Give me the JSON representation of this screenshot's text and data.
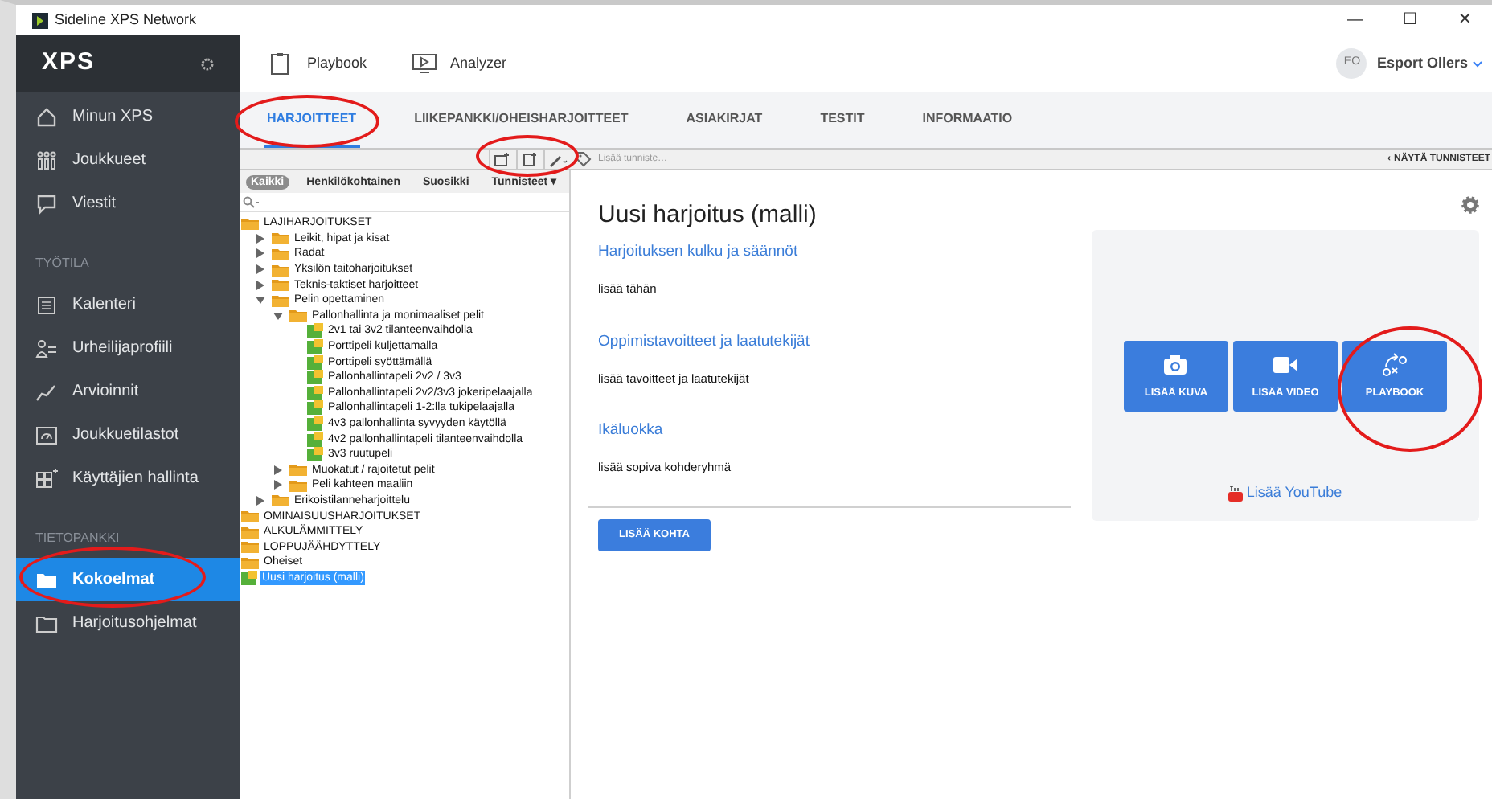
{
  "window": {
    "title": "Sideline XPS Network",
    "controls": [
      "—",
      "☐",
      "✕"
    ]
  },
  "sidebar": {
    "logo": "XPS",
    "items": [
      {
        "kind": "item",
        "label": "Minun XPS",
        "selected": false
      },
      {
        "kind": "item",
        "label": "Joukkueet",
        "selected": false
      },
      {
        "kind": "item",
        "label": "Viestit",
        "selected": false
      },
      {
        "kind": "header",
        "label": "TYÖTILA"
      },
      {
        "kind": "item",
        "label": "Kalenteri",
        "selected": false
      },
      {
        "kind": "item",
        "label": "Urheilijaprofiili",
        "selected": false
      },
      {
        "kind": "item",
        "label": "Arvioinnit",
        "selected": false
      },
      {
        "kind": "item",
        "label": "Joukkuetilastot",
        "selected": false
      },
      {
        "kind": "item",
        "label": "Käyttäjien hallinta",
        "selected": false
      },
      {
        "kind": "header",
        "label": "TIETOPANKKI"
      },
      {
        "kind": "item",
        "label": "Kokoelmat",
        "selected": true
      },
      {
        "kind": "item",
        "label": "Harjoitusohjelmat",
        "selected": false
      }
    ]
  },
  "apps": [
    {
      "label": "Playbook"
    },
    {
      "label": "Analyzer"
    }
  ],
  "user": {
    "initials": "EO",
    "name": "Esport Ollers"
  },
  "tabs": [
    {
      "label": "HARJOITTEET",
      "selected": true
    },
    {
      "label": "LIIKEPANKKI/OHEISHARJOITTEET",
      "selected": false
    },
    {
      "label": "ASIAKIRJAT",
      "selected": false
    },
    {
      "label": "TESTIT",
      "selected": false
    },
    {
      "label": "INFORMAATIO",
      "selected": false
    }
  ],
  "tag_bar": {
    "placeholder": "Lisää tunniste…",
    "show_tags": "NÄYTÄ TUNNISTEET",
    "chevron": "‹"
  },
  "filters": [
    {
      "label": "Kaikki",
      "selected": true
    },
    {
      "label": "Henkilökohtainen",
      "selected": false
    },
    {
      "label": "Suosikki",
      "selected": false
    },
    {
      "label": "Tunnisteet ▾",
      "selected": false
    }
  ],
  "tree": [
    {
      "kind": "folder",
      "label": "LAJIHARJOITUKSET",
      "selected": false,
      "children": [
        {
          "kind": "folder",
          "label": "Leikit, hipat ja kisat",
          "expanded": false,
          "selected": false
        },
        {
          "kind": "folder",
          "label": "Radat",
          "expanded": false,
          "selected": false
        },
        {
          "kind": "folder",
          "label": "Yksilön taitoharjoitukset",
          "expanded": false,
          "selected": false
        },
        {
          "kind": "folder",
          "label": "Teknis-taktiset harjoitteet",
          "expanded": false,
          "selected": false
        },
        {
          "kind": "folder",
          "label": "Pelin opettaminen",
          "expanded": true,
          "selected": false,
          "children": [
            {
              "kind": "folder",
              "label": "Pallonhallinta ja monimaaliset pelit",
              "expanded": true,
              "selected": false,
              "children": [
                {
                  "kind": "drill",
                  "label": "2v1 tai 3v2 tilanteenvaihdolla",
                  "selected": false
                },
                {
                  "kind": "drill",
                  "label": "Porttipeli kuljettamalla",
                  "selected": false
                },
                {
                  "kind": "drill",
                  "label": "Porttipeli syöttämällä",
                  "selected": false
                },
                {
                  "kind": "drill",
                  "label": "Pallonhallintapeli 2v2 / 3v3",
                  "selected": false
                },
                {
                  "kind": "drill",
                  "label": "Pallonhallintapeli 2v2/3v3 jokeripelaajalla",
                  "selected": false
                },
                {
                  "kind": "drill",
                  "label": "Pallonhallintapeli 1-2:lla tukipelaajalla",
                  "selected": false
                },
                {
                  "kind": "drill",
                  "label": "4v3 pallonhallinta syvyyden käytöllä",
                  "selected": false
                },
                {
                  "kind": "drill",
                  "label": "4v2 pallonhallintapeli tilanteenvaihdolla",
                  "selected": false
                },
                {
                  "kind": "drill",
                  "label": "3v3 ruutupeli",
                  "selected": false
                }
              ]
            },
            {
              "kind": "folder",
              "label": "Muokatut / rajoitetut pelit",
              "expanded": false,
              "selected": false
            },
            {
              "kind": "folder",
              "label": "Peli kahteen maaliin",
              "expanded": false,
              "selected": false
            }
          ]
        },
        {
          "kind": "folder",
          "label": "Erikoistilanneharjoittelu",
          "expanded": false,
          "selected": false
        }
      ]
    },
    {
      "kind": "folder",
      "label": "OMINAISUUSHARJOITUKSET",
      "selected": false
    },
    {
      "kind": "folder",
      "label": "ALKULÄMMITTELY",
      "selected": false
    },
    {
      "kind": "folder",
      "label": "LOPPUJÄÄHDYTTELY",
      "selected": false
    },
    {
      "kind": "folder",
      "label": "Oheiset",
      "selected": false
    },
    {
      "kind": "drill",
      "label": "Uusi harjoitus (malli)",
      "selected": true
    }
  ],
  "detail": {
    "title": "Uusi harjoitus (malli)",
    "sections": [
      {
        "heading": "Harjoituksen kulku ja säännöt",
        "text": "lisää tähän"
      },
      {
        "heading": "Oppimistavoitteet ja laatutekijät",
        "text": "lisää tavoitteet ja laatutekijät"
      },
      {
        "heading": "Ikäluokka",
        "text": "lisää sopiva kohderyhmä"
      }
    ],
    "add_button": "LISÄÄ KOHTA",
    "media_buttons": [
      {
        "label": "LISÄÄ KUVA"
      },
      {
        "label": "LISÄÄ VIDEO"
      },
      {
        "label": "PLAYBOOK"
      }
    ],
    "youtube_link": "Lisää YouTube"
  }
}
